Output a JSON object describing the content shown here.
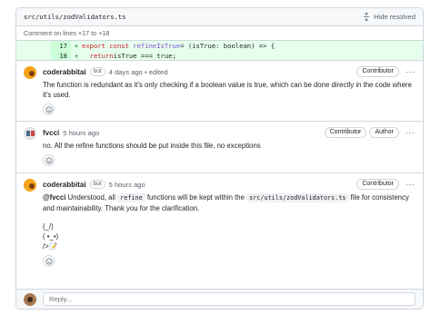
{
  "file": {
    "path": "src/utils/zodValidators.ts",
    "hide_resolved_label": "Hide resolved"
  },
  "comment_on": "Comment on lines +17 to +18",
  "diff": [
    {
      "line": "17",
      "marker": "+",
      "kw": "export const",
      "name": "refineIsTrue",
      "rest": " = (isTrue: boolean) => {"
    },
    {
      "line": "18",
      "marker": "+",
      "kw": "return",
      "name": "",
      "rest": " isTrue === true;"
    }
  ],
  "comments": [
    {
      "author": "coderabbitai",
      "bot_badge": "bot",
      "time": "4 days ago",
      "edited": "• edited",
      "badges": [
        "Contributor"
      ],
      "body": "The function is redundant as it's only checking if a boolean value is true, which can be done directly in the code where it's used."
    },
    {
      "author": "fvcci",
      "time": "5 hours ago",
      "badges": [
        "Contributor",
        "Author"
      ],
      "body": "no. All the refine functions should be put inside this file, no exceptions"
    },
    {
      "author": "coderabbitai",
      "bot_badge": "bot",
      "time": "5 hours ago",
      "badges": [
        "Contributor"
      ],
      "mention": "@fvcci",
      "body_a": " Understood, all ",
      "code1": "refine",
      "body_b": " functions will be kept within the ",
      "code2": "src/utils/zodValidators.ts",
      "body_c": " file for consistency and maintainability. Thank you for the clarification.",
      "art1": "(_/)",
      "art2": "( •_•)",
      "art3": "/>📝"
    }
  ],
  "reply_placeholder": "Reply...",
  "more_label": "···"
}
